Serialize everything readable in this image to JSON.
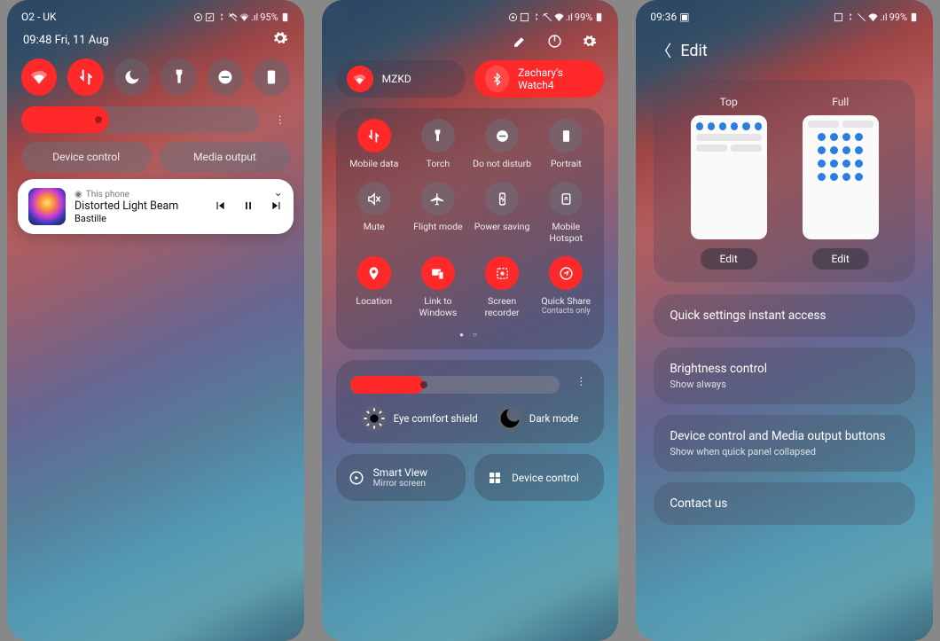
{
  "p1": {
    "status": {
      "left": "O2 - UK",
      "batt": "95%"
    },
    "time": "09:48  Fri, 11 Aug",
    "device_control": "Device control",
    "media_output": "Media output",
    "media": {
      "source": "This phone",
      "title": "Distorted Light Beam",
      "artist": "Bastille"
    },
    "brightness_pct": 37
  },
  "p2": {
    "status": {
      "batt": "99%"
    },
    "wifi_name": "MZKD",
    "bt_name": "Zachary's Watch4",
    "tiles": {
      "mobile": "Mobile data",
      "torch": "Torch",
      "dnd": "Do not disturb",
      "portrait": "Portrait",
      "mute": "Mute",
      "flight": "Flight mode",
      "power": "Power saving",
      "hotspot": "Mobile Hotspot",
      "location": "Location",
      "linkwin": "Link to Windows",
      "screc": "Screen recorder",
      "qshare": "Quick Share",
      "qshare_sub": "Contacts only"
    },
    "brightness_pct": 35,
    "eye": "Eye comfort shield",
    "dark": "Dark mode",
    "smartview": "Smart View",
    "smartview_sub": "Mirror screen",
    "devctrl": "Device control"
  },
  "p3": {
    "status": {
      "left": "09:36",
      "batt": "99%"
    },
    "hdr_title": "Edit",
    "top": "Top",
    "full": "Full",
    "edit": "Edit",
    "s1": "Quick settings instant access",
    "s2": "Brightness control",
    "s2_sub": "Show always",
    "s3": "Device control and Media output buttons",
    "s3_sub": "Show when quick panel collapsed",
    "s4": "Contact us"
  }
}
